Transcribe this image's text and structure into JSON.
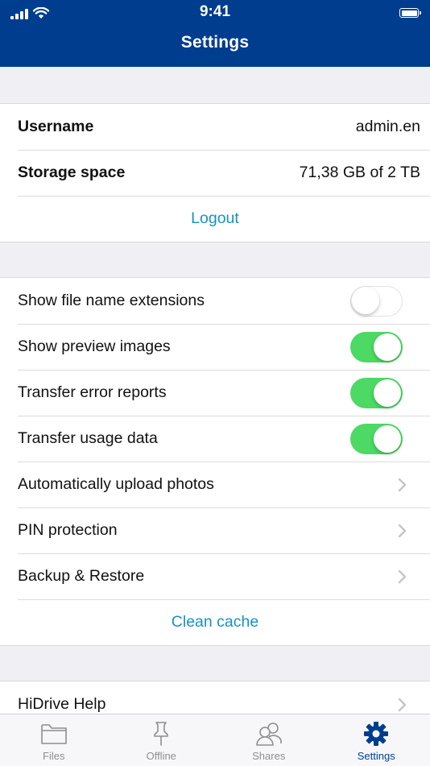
{
  "status_bar": {
    "time": "9:41"
  },
  "nav": {
    "title": "Settings"
  },
  "account": {
    "username_label": "Username",
    "username_value": "admin.en",
    "storage_label": "Storage space",
    "storage_value": "71,38 GB of 2 TB",
    "logout_label": "Logout"
  },
  "options": {
    "items": [
      {
        "label": "Show file name extensions",
        "toggle": false
      },
      {
        "label": "Show preview images",
        "toggle": true
      },
      {
        "label": "Transfer error reports",
        "toggle": true
      },
      {
        "label": "Transfer usage data",
        "toggle": true
      },
      {
        "label": "Automatically upload photos",
        "icon": "chevron-right-icon"
      },
      {
        "label": "PIN protection",
        "icon": "chevron-right-icon"
      },
      {
        "label": "Backup & Restore",
        "icon": "chevron-right-icon"
      }
    ],
    "clean_cache_label": "Clean cache"
  },
  "help": {
    "label": "HiDrive Help",
    "icon": "chevron-right-icon"
  },
  "tabbar": {
    "tabs": [
      {
        "label": "Files",
        "icon": "folder-icon",
        "active": false
      },
      {
        "label": "Offline",
        "icon": "pin-icon",
        "active": false
      },
      {
        "label": "Shares",
        "icon": "users-icon",
        "active": false
      },
      {
        "label": "Settings",
        "icon": "gear-icon",
        "active": true
      }
    ]
  },
  "colors": {
    "nav_background": "#003d8f",
    "link": "#1592c4",
    "toggle_on": "#4cd964",
    "tab_active": "#003d8f",
    "tab_inactive": "#8e8e93"
  }
}
